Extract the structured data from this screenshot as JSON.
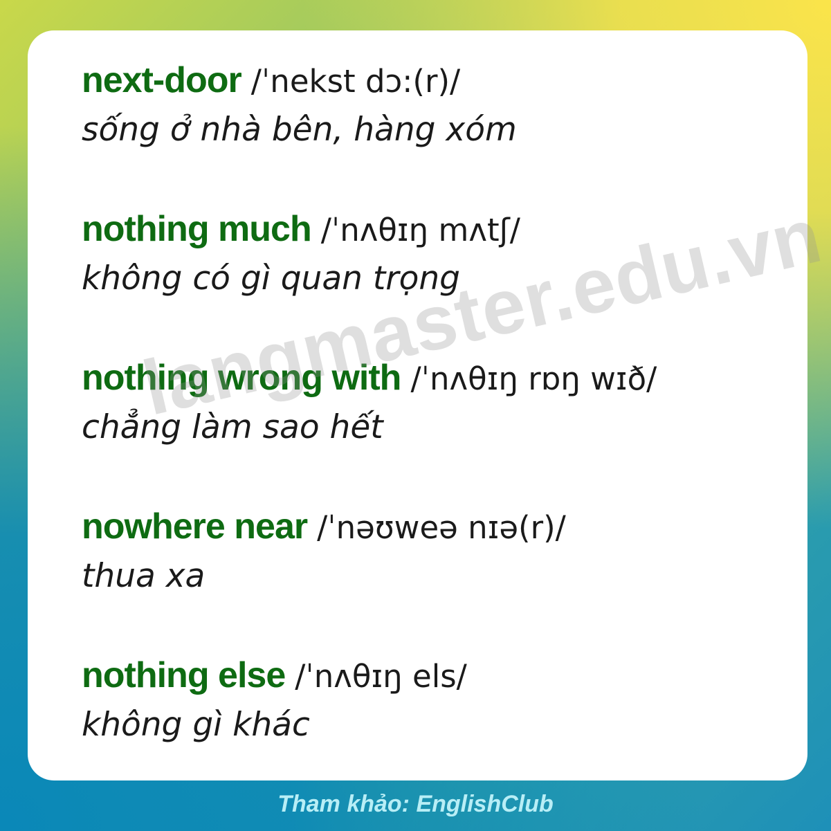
{
  "entries": [
    {
      "term": "next-door",
      "ipa": "/ˈnekst dɔ:(r)/",
      "meaning": "sống ở nhà bên, hàng xóm"
    },
    {
      "term": "nothing much",
      "ipa": "/ˈnʌθɪŋ mʌtʃ/",
      "meaning": "không có gì quan trọng"
    },
    {
      "term": "nothing wrong with",
      "ipa": "/ˈnʌθɪŋ rɒŋ wɪð/",
      "meaning": "chẳng làm sao hết"
    },
    {
      "term": "nowhere near",
      "ipa": "/ˈnəʊweə nɪə(r)/",
      "meaning": "thua xa"
    },
    {
      "term": "nothing else",
      "ipa": "/ˈnʌθɪŋ els/",
      "meaning": "không gì khác"
    }
  ],
  "watermark": "langmaster.edu.vn",
  "footer": "Tham khảo: EnglishClub",
  "colors": {
    "term": "#0e6b12",
    "text": "#1a1a1a",
    "card": "#ffffff",
    "footer": "#b8eef6",
    "gradient_top_right": "#fbe44a",
    "gradient_bottom_left": "#0a88b8"
  }
}
